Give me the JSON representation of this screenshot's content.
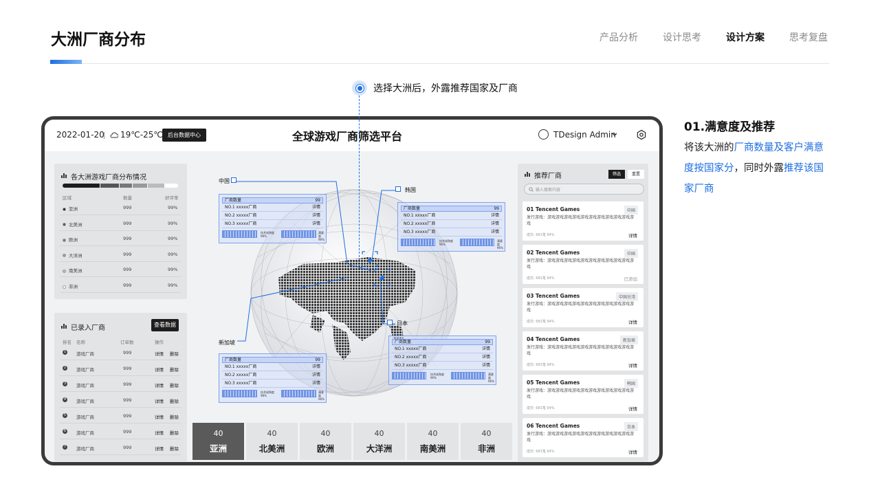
{
  "page": {
    "title": "大洲厂商分布",
    "nav": [
      "产品分析",
      "设计思考",
      "设计方案",
      "思考复盘"
    ],
    "nav_active": "设计方案"
  },
  "annotation": {
    "text": "选择大洲后，外露推荐国家及厂商"
  },
  "description": {
    "title": "01.满意度及推荐",
    "parts": [
      "将该大洲的",
      "厂商数量及客户满意度按国家分",
      "，同时外露",
      "推荐该国家厂商"
    ]
  },
  "device": {
    "topbar": {
      "date": "2022-01-20",
      "weather": "19℃-25℃",
      "backend_button": "后台数据中心",
      "title": "全球游戏厂商筛选平台",
      "user": "TDesign Admin"
    },
    "distribution": {
      "title": "各大洲游戏厂商分布情况",
      "columns": [
        "区域",
        "数量",
        "好评率"
      ],
      "rows": [
        {
          "region": "亚洲",
          "count": "999",
          "rate": "99%",
          "color": "#222222"
        },
        {
          "region": "北美洲",
          "count": "999",
          "rate": "99%",
          "color": "#555555"
        },
        {
          "region": "欧洲",
          "count": "999",
          "rate": "99%",
          "color": "#777777"
        },
        {
          "region": "大洋洲",
          "count": "999",
          "rate": "99%",
          "color": "#999999"
        },
        {
          "region": "南美洲",
          "count": "999",
          "rate": "99%",
          "color": "#bbbbbb"
        },
        {
          "region": "非洲",
          "count": "999",
          "rate": "99%",
          "color": "#ffffff"
        }
      ]
    },
    "entered": {
      "title": "已录入厂商",
      "button": "查看数据",
      "columns": [
        "排名",
        "名称",
        "订单数",
        "操作"
      ],
      "rows": [
        {
          "rank": "1",
          "name": "游戏厂商",
          "orders": "999",
          "detail": "详情",
          "delete": "删除"
        },
        {
          "rank": "2",
          "name": "游戏厂商",
          "orders": "999",
          "detail": "详情",
          "delete": "删除"
        },
        {
          "rank": "3",
          "name": "游戏厂商",
          "orders": "999",
          "detail": "详情",
          "delete": "删除"
        },
        {
          "rank": "4",
          "name": "游戏厂商",
          "orders": "999",
          "detail": "详情",
          "delete": "删除"
        },
        {
          "rank": "5",
          "name": "游戏厂商",
          "orders": "999",
          "detail": "详情",
          "delete": "删除"
        },
        {
          "rank": "6",
          "name": "游戏厂商",
          "orders": "999",
          "detail": "详情",
          "delete": "删除"
        },
        {
          "rank": "7",
          "name": "游戏厂商",
          "orders": "999",
          "detail": "详情",
          "delete": "删除"
        }
      ]
    },
    "countries": [
      {
        "name": "中国",
        "header": "厂商数量",
        "count": "99",
        "items": [
          {
            "label": "NO.1  xxxxx厂商",
            "action": "详情"
          },
          {
            "label": "NO.2  xxxxx厂商",
            "action": "详情"
          },
          {
            "label": "NO.3  xxxxx厂商",
            "action": "详情"
          }
        ],
        "tech_label": "技术成熟度",
        "tech_value": "98%",
        "tech_level": 0.98,
        "sat_label": "满意度",
        "sat_value": "98%",
        "sat_level": 0.98
      },
      {
        "name": "韩国",
        "header": "厂商数量",
        "count": "99",
        "items": [
          {
            "label": "NO.1  xxxxx厂商",
            "action": "详情"
          },
          {
            "label": "NO.2  xxxxx厂商",
            "action": "详情"
          },
          {
            "label": "NO.3  xxxxx厂商",
            "action": "详情"
          }
        ],
        "tech_label": "技术成熟度",
        "tech_value": "96%",
        "tech_level": 0.96,
        "sat_label": "满意度",
        "sat_value": "96%",
        "sat_level": 0.96
      },
      {
        "name": "日本",
        "header": "厂商数量",
        "count": "99",
        "items": [
          {
            "label": "NO.1  xxxxx厂商",
            "action": "详情"
          },
          {
            "label": "NO.2  xxxxx厂商",
            "action": "详情"
          },
          {
            "label": "NO.3  xxxxx厂商",
            "action": "详情"
          }
        ],
        "tech_label": "技术成熟度",
        "tech_value": "96%",
        "tech_level": 0.96,
        "sat_label": "满意度",
        "sat_value": "96%",
        "sat_level": 0.96
      },
      {
        "name": "新加坡",
        "header": "厂商数量",
        "count": "99",
        "items": [
          {
            "label": "NO.1  xxxxx厂商",
            "action": "详情"
          },
          {
            "label": "NO.2  xxxxx厂商",
            "action": "详情"
          },
          {
            "label": "NO.3  xxxxx厂商",
            "action": "详情"
          }
        ],
        "tech_label": "技术成熟度",
        "tech_value": "98%",
        "tech_level": 0.98,
        "sat_label": "满意度",
        "sat_value": "98%",
        "sat_level": 0.98
      }
    ],
    "continents": [
      {
        "count": "40",
        "name": "亚洲",
        "active": true
      },
      {
        "count": "40",
        "name": "北美洲",
        "active": false
      },
      {
        "count": "40",
        "name": "欧洲",
        "active": false
      },
      {
        "count": "40",
        "name": "大洋洲",
        "active": false
      },
      {
        "count": "40",
        "name": "南美洲",
        "active": false
      },
      {
        "count": "40",
        "name": "非洲",
        "active": false
      }
    ],
    "recommend": {
      "title": "推荐厂商",
      "filter_button": "筛选",
      "reset_button": "重置",
      "search_placeholder": "输入搜索内容",
      "cards": [
        {
          "title": "01 Tencent Games",
          "tag": "中国",
          "desc": "发行游戏：游戏游戏游戏游戏游戏游戏游戏游戏游戏游戏游戏",
          "meta": "成交: 681笔   94%",
          "action": "详情",
          "muted": false
        },
        {
          "title": "02 Tencent Games",
          "tag": "中国",
          "desc": "发行游戏：游戏游戏游戏游戏游戏游戏游戏游戏游戏游戏游戏",
          "meta": "成交: 681笔   94%",
          "action": "已添加",
          "muted": true
        },
        {
          "title": "03 Tencent Games",
          "tag": "中国台湾",
          "desc": "发行游戏：游戏游戏游戏游戏游戏游戏游戏游戏游戏游戏游戏",
          "meta": "成交: 681笔   94%",
          "action": "详情",
          "muted": false
        },
        {
          "title": "04 Tencent Games",
          "tag": "新加坡",
          "desc": "发行游戏：游戏游戏游戏游戏游戏游戏游戏游戏游戏游戏游戏",
          "meta": "成交: 681笔   94%",
          "action": "详情",
          "muted": false
        },
        {
          "title": "05 Tencent Games",
          "tag": "韩国",
          "desc": "发行游戏：游戏游戏游戏游戏游戏游戏游戏游戏游戏游戏游戏",
          "meta": "成交: 681笔   94%",
          "action": "详情",
          "muted": false
        },
        {
          "title": "06 Tencent Games",
          "tag": "日本",
          "desc": "发行游戏：游戏游戏游戏游戏游戏游戏游戏游戏游戏游戏游戏",
          "meta": "成交: 681笔   94%",
          "action": "详情",
          "muted": false
        }
      ]
    }
  },
  "colors": {
    "accent": "#1e6fe0",
    "card_blue": "#c6d4f6",
    "dark_button": "#1d1d1d",
    "active_tab": "#5a5a5a"
  },
  "icons": [
    "cloud-icon",
    "user-icon",
    "chevron-down-icon",
    "settings-icon",
    "bar-chart-icon",
    "search-icon",
    "like-icon",
    "locate-dot-icon"
  ]
}
